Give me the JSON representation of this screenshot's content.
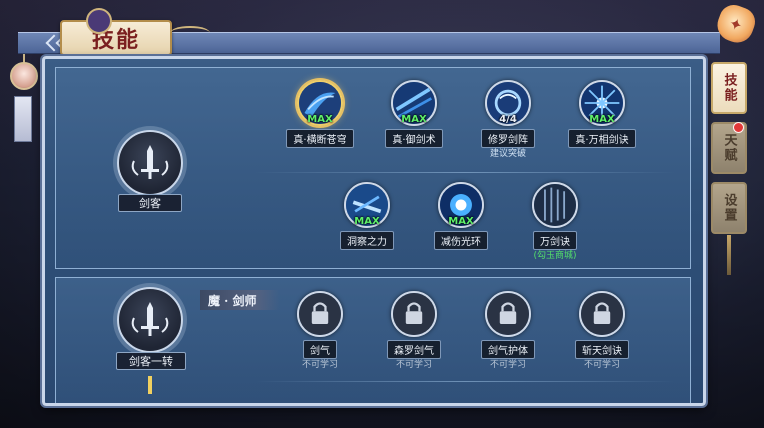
{
  "header": {
    "title": "技能"
  },
  "side_tabs": [
    {
      "label": "技能",
      "active": true
    },
    {
      "label": "天赋",
      "active": false,
      "badge": true
    },
    {
      "label": "设置",
      "active": false
    }
  ],
  "class1": {
    "label": "剑客"
  },
  "class2": {
    "label": "剑客一转",
    "sub_tag": "魔 · 剑师"
  },
  "skills_row1": [
    {
      "name": "真·横断苍穹",
      "level": "MAX",
      "selected": true
    },
    {
      "name": "真·御剑术",
      "level": "MAX"
    },
    {
      "name": "修罗剑阵",
      "level": "4/4",
      "note": "建议突破"
    },
    {
      "name": "真·万相剑诀",
      "level": "MAX"
    }
  ],
  "skills_row2": [
    {
      "name": "洞察之力",
      "level": "MAX"
    },
    {
      "name": "减伤光环",
      "level": "MAX"
    },
    {
      "name": "万剑诀",
      "note": "(勾玉商城)"
    }
  ],
  "skills_row3": [
    {
      "name": "剑气",
      "note": "不可学习"
    },
    {
      "name": "森罗剑气",
      "note": "不可学习"
    },
    {
      "name": "剑气护体",
      "note": "不可学习"
    },
    {
      "name": "斩天剑诀",
      "note": "不可学习"
    }
  ],
  "colors": {
    "max_green": "#5ef06a",
    "selected_gold": "#f0cf6a",
    "panel_blue": "#2f5078"
  },
  "icons": {
    "class": "sword-emblem-icon",
    "lock": "lock-icon",
    "badge": "red-dot-icon"
  }
}
